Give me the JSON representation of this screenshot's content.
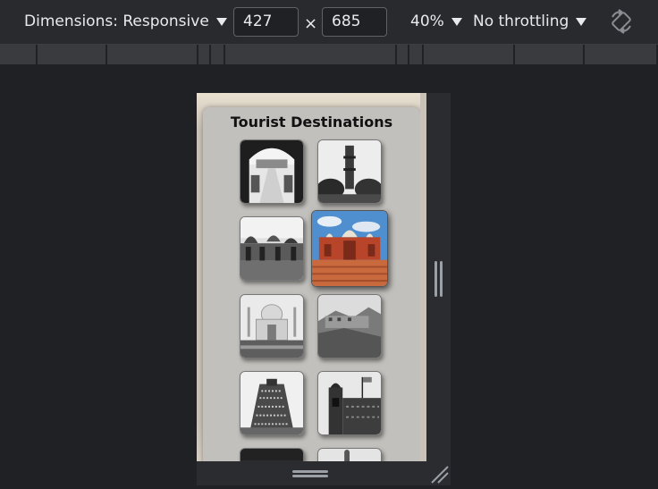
{
  "toolbar": {
    "dimensions_label": "Dimensions: Responsive",
    "width_value": "427",
    "times_symbol": "×",
    "height_value": "685",
    "zoom_label": "40%",
    "throttling_label": "No throttling",
    "rotate_icon": "rotate-icon"
  },
  "page": {
    "title": "Tourist Destinations",
    "thumbnails": [
      {
        "name": "arch-courtyard"
      },
      {
        "name": "minaret-tower"
      },
      {
        "name": "cenotaphs"
      },
      {
        "name": "red-fort-mosque"
      },
      {
        "name": "taj-mahal"
      },
      {
        "name": "hill-fort"
      },
      {
        "name": "temple-gopuram"
      },
      {
        "name": "palace-with-flag"
      },
      {
        "name": "partial-dark"
      },
      {
        "name": "partial-statue"
      }
    ]
  },
  "colors": {
    "toolbar_bg": "#292a2d",
    "canvas_bg": "#202124",
    "card_bg": "#c2c0bc",
    "text": "#e8eaed"
  }
}
